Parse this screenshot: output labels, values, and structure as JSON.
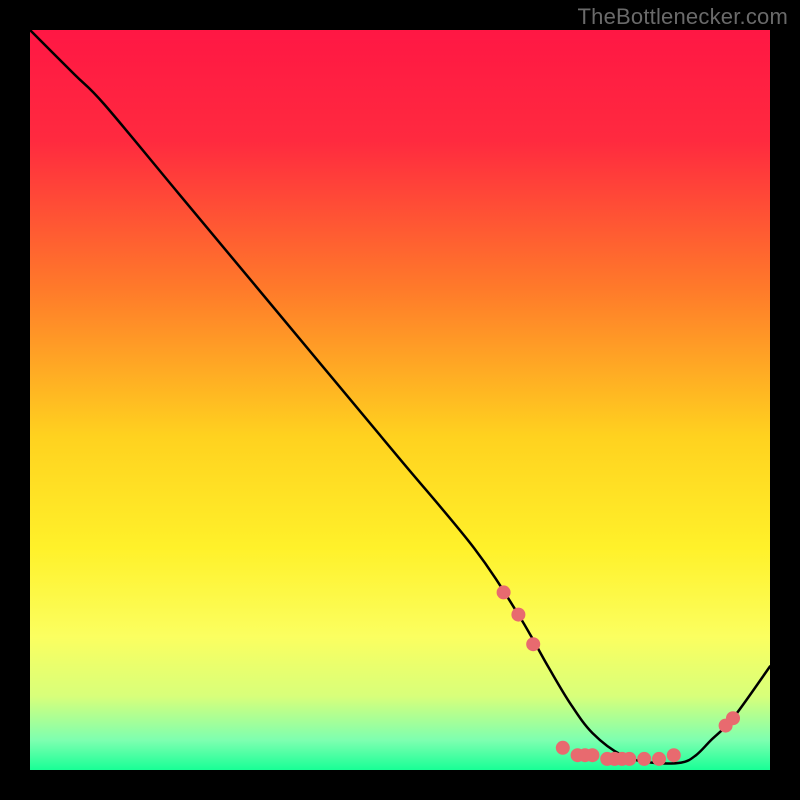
{
  "watermark": "TheBottlenecker.com",
  "chart_data": {
    "type": "line",
    "title": "",
    "xlabel": "",
    "ylabel": "",
    "xlim": [
      0,
      100
    ],
    "ylim": [
      0,
      100
    ],
    "gradient_stops": [
      {
        "offset": 0.0,
        "color": "#ff1744"
      },
      {
        "offset": 0.15,
        "color": "#ff2a3f"
      },
      {
        "offset": 0.35,
        "color": "#ff7a2a"
      },
      {
        "offset": 0.55,
        "color": "#ffd21f"
      },
      {
        "offset": 0.7,
        "color": "#fff12a"
      },
      {
        "offset": 0.82,
        "color": "#fbff60"
      },
      {
        "offset": 0.9,
        "color": "#d8ff7a"
      },
      {
        "offset": 0.96,
        "color": "#7dffb0"
      },
      {
        "offset": 1.0,
        "color": "#18ff96"
      }
    ],
    "series": [
      {
        "name": "bottleneck-curve",
        "x": [
          0,
          6,
          10,
          20,
          30,
          40,
          50,
          60,
          66,
          70,
          73,
          76,
          80,
          84,
          88,
          90,
          92,
          95,
          100
        ],
        "y": [
          100,
          94,
          90,
          78,
          66,
          54,
          42,
          30,
          21,
          14,
          9,
          5,
          2,
          1,
          1,
          2,
          4,
          7,
          14
        ]
      }
    ],
    "markers": {
      "name": "highlight-points",
      "color": "#e86a6f",
      "radius": 7,
      "points": [
        {
          "x": 64,
          "y": 24
        },
        {
          "x": 66,
          "y": 21
        },
        {
          "x": 68,
          "y": 17
        },
        {
          "x": 72,
          "y": 3
        },
        {
          "x": 74,
          "y": 2
        },
        {
          "x": 75,
          "y": 2
        },
        {
          "x": 76,
          "y": 2
        },
        {
          "x": 78,
          "y": 1.5
        },
        {
          "x": 79,
          "y": 1.5
        },
        {
          "x": 80,
          "y": 1.5
        },
        {
          "x": 81,
          "y": 1.5
        },
        {
          "x": 83,
          "y": 1.5
        },
        {
          "x": 85,
          "y": 1.5
        },
        {
          "x": 87,
          "y": 2
        },
        {
          "x": 94,
          "y": 6
        },
        {
          "x": 95,
          "y": 7
        }
      ]
    }
  }
}
